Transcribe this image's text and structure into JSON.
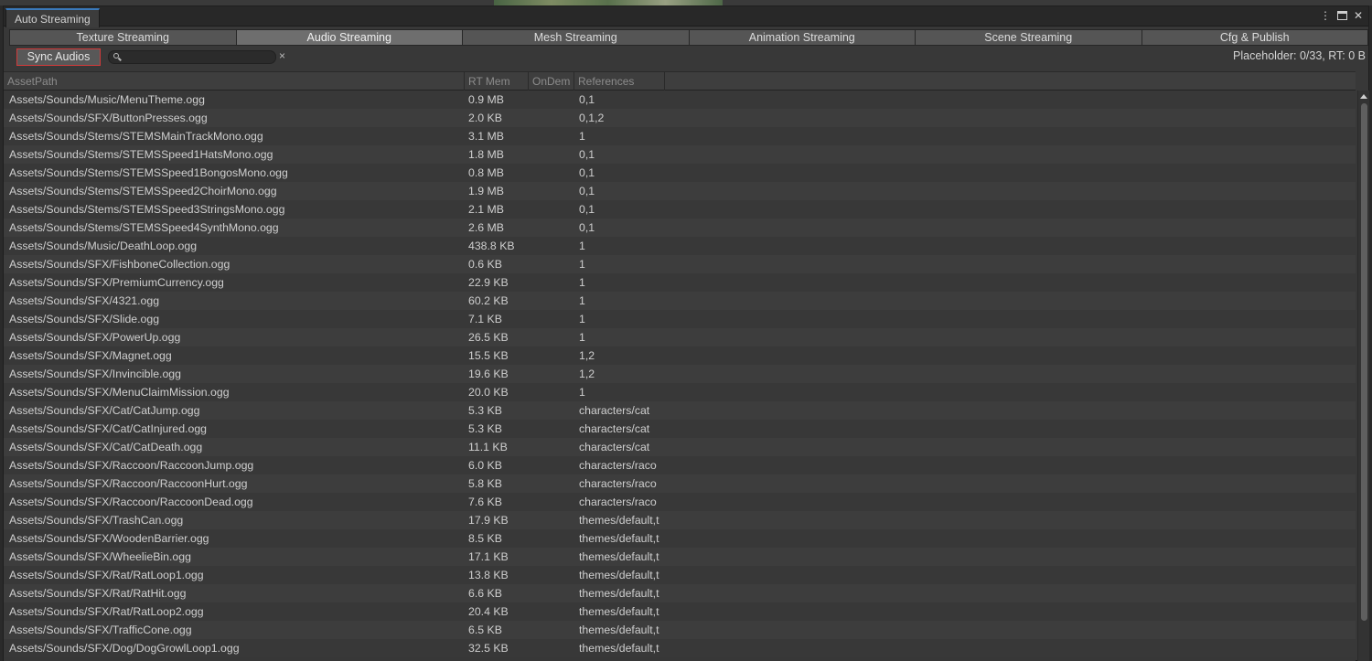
{
  "window": {
    "title": "Auto Streaming"
  },
  "tabs": [
    {
      "label": "Texture Streaming",
      "active": false
    },
    {
      "label": "Audio Streaming",
      "active": true
    },
    {
      "label": "Mesh Streaming",
      "active": false
    },
    {
      "label": "Animation Streaming",
      "active": false
    },
    {
      "label": "Scene Streaming",
      "active": false
    },
    {
      "label": "Cfg & Publish",
      "active": false
    }
  ],
  "toolbar": {
    "sync_label": "Sync Audios",
    "search_value": "",
    "clear_glyph": "×",
    "status": "Placeholder: 0/33, RT: 0 B"
  },
  "columns": {
    "path": "AssetPath",
    "mem": "RT Mem",
    "ondemand": "OnDem",
    "refs": "References"
  },
  "rows": [
    {
      "path": "Assets/Sounds/Music/MenuTheme.ogg",
      "mem": "0.9 MB",
      "refs": "0,1"
    },
    {
      "path": "Assets/Sounds/SFX/ButtonPresses.ogg",
      "mem": "2.0 KB",
      "refs": "0,1,2"
    },
    {
      "path": "Assets/Sounds/Stems/STEMSMainTrackMono.ogg",
      "mem": "3.1 MB",
      "refs": "1"
    },
    {
      "path": "Assets/Sounds/Stems/STEMSSpeed1HatsMono.ogg",
      "mem": "1.8 MB",
      "refs": "0,1"
    },
    {
      "path": "Assets/Sounds/Stems/STEMSSpeed1BongosMono.ogg",
      "mem": "0.8 MB",
      "refs": "0,1"
    },
    {
      "path": "Assets/Sounds/Stems/STEMSSpeed2ChoirMono.ogg",
      "mem": "1.9 MB",
      "refs": "0,1"
    },
    {
      "path": "Assets/Sounds/Stems/STEMSSpeed3StringsMono.ogg",
      "mem": "2.1 MB",
      "refs": "0,1"
    },
    {
      "path": "Assets/Sounds/Stems/STEMSSpeed4SynthMono.ogg",
      "mem": "2.6 MB",
      "refs": "0,1"
    },
    {
      "path": "Assets/Sounds/Music/DeathLoop.ogg",
      "mem": "438.8 KB",
      "refs": "1"
    },
    {
      "path": "Assets/Sounds/SFX/FishboneCollection.ogg",
      "mem": "0.6 KB",
      "refs": "1"
    },
    {
      "path": "Assets/Sounds/SFX/PremiumCurrency.ogg",
      "mem": "22.9 KB",
      "refs": "1"
    },
    {
      "path": "Assets/Sounds/SFX/4321.ogg",
      "mem": "60.2 KB",
      "refs": "1"
    },
    {
      "path": "Assets/Sounds/SFX/Slide.ogg",
      "mem": "7.1 KB",
      "refs": "1"
    },
    {
      "path": "Assets/Sounds/SFX/PowerUp.ogg",
      "mem": "26.5 KB",
      "refs": "1"
    },
    {
      "path": "Assets/Sounds/SFX/Magnet.ogg",
      "mem": "15.5 KB",
      "refs": "1,2"
    },
    {
      "path": "Assets/Sounds/SFX/Invincible.ogg",
      "mem": "19.6 KB",
      "refs": "1,2"
    },
    {
      "path": "Assets/Sounds/SFX/MenuClaimMission.ogg",
      "mem": "20.0 KB",
      "refs": "1"
    },
    {
      "path": "Assets/Sounds/SFX/Cat/CatJump.ogg",
      "mem": "5.3 KB",
      "refs": "characters/cat"
    },
    {
      "path": "Assets/Sounds/SFX/Cat/CatInjured.ogg",
      "mem": "5.3 KB",
      "refs": "characters/cat"
    },
    {
      "path": "Assets/Sounds/SFX/Cat/CatDeath.ogg",
      "mem": "11.1 KB",
      "refs": "characters/cat"
    },
    {
      "path": "Assets/Sounds/SFX/Raccoon/RaccoonJump.ogg",
      "mem": "6.0 KB",
      "refs": "characters/raco"
    },
    {
      "path": "Assets/Sounds/SFX/Raccoon/RaccoonHurt.ogg",
      "mem": "5.8 KB",
      "refs": "characters/raco"
    },
    {
      "path": "Assets/Sounds/SFX/Raccoon/RaccoonDead.ogg",
      "mem": "7.6 KB",
      "refs": "characters/raco"
    },
    {
      "path": "Assets/Sounds/SFX/TrashCan.ogg",
      "mem": "17.9 KB",
      "refs": "themes/default,t"
    },
    {
      "path": "Assets/Sounds/SFX/WoodenBarrier.ogg",
      "mem": "8.5 KB",
      "refs": "themes/default,t"
    },
    {
      "path": "Assets/Sounds/SFX/WheelieBin.ogg",
      "mem": "17.1 KB",
      "refs": "themes/default,t"
    },
    {
      "path": "Assets/Sounds/SFX/Rat/RatLoop1.ogg",
      "mem": "13.8 KB",
      "refs": "themes/default,t"
    },
    {
      "path": "Assets/Sounds/SFX/Rat/RatHit.ogg",
      "mem": "6.6 KB",
      "refs": "themes/default,t"
    },
    {
      "path": "Assets/Sounds/SFX/Rat/RatLoop2.ogg",
      "mem": "20.4 KB",
      "refs": "themes/default,t"
    },
    {
      "path": "Assets/Sounds/SFX/TrafficCone.ogg",
      "mem": "6.5 KB",
      "refs": "themes/default,t"
    },
    {
      "path": "Assets/Sounds/SFX/Dog/DogGrowlLoop1.ogg",
      "mem": "32.5 KB",
      "refs": "themes/default,t"
    }
  ]
}
